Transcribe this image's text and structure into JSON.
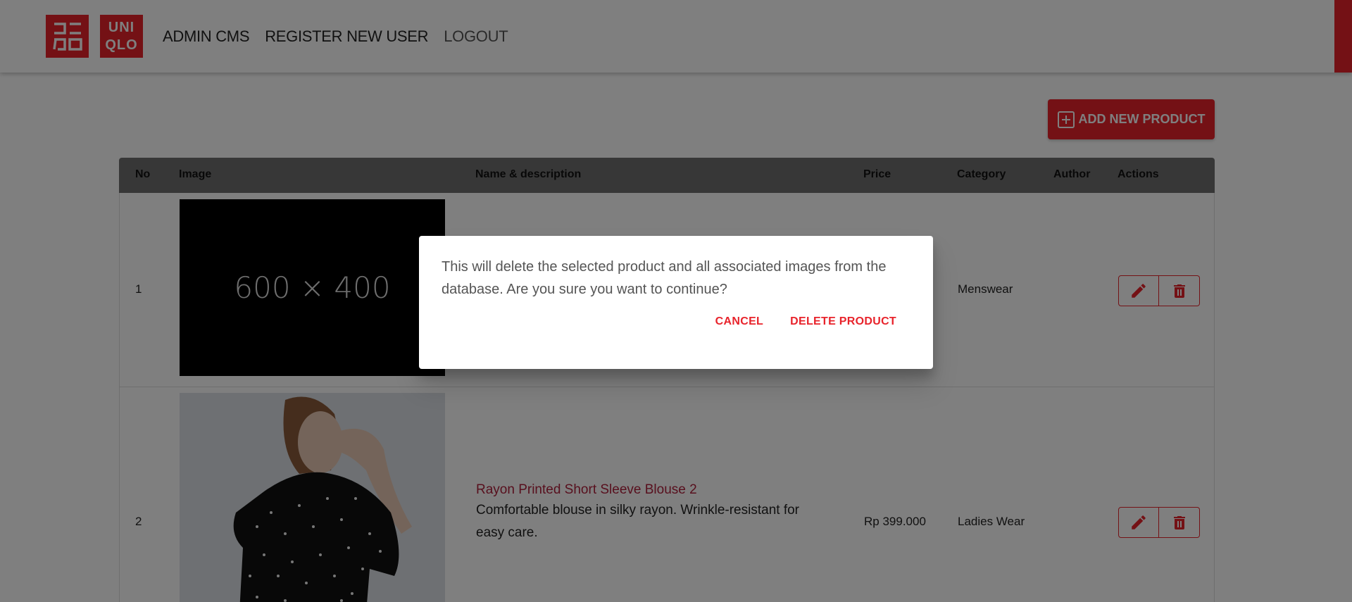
{
  "header": {
    "logo_top": "ユニクロ",
    "logo_text_line1": "UNI",
    "logo_text_line2": "QLO",
    "nav": [
      {
        "label": "ADMIN CMS"
      },
      {
        "label": "REGISTER NEW USER"
      },
      {
        "label": "LOGOUT"
      }
    ]
  },
  "toolbar": {
    "add_label": "ADD NEW PRODUCT"
  },
  "table": {
    "columns": [
      "No",
      "Image",
      "Name & description",
      "Price",
      "Category",
      "Author",
      "Actions"
    ],
    "rows": [
      {
        "no": "1",
        "image_placeholder": "600 × 400",
        "name": "",
        "description": "",
        "price": "",
        "category": "Menswear",
        "author": ""
      },
      {
        "no": "2",
        "image_placeholder": "",
        "name": "Rayon Printed Short Sleeve Blouse 2",
        "description": "Comfortable blouse in silky rayon. Wrinkle-resistant for easy care.",
        "price": "Rp 399.000",
        "category": "Ladies Wear",
        "author": ""
      }
    ]
  },
  "dialog": {
    "message": "This will delete the selected product and all associated images from the database. Are you sure you want to continue?",
    "cancel_label": "CANCEL",
    "confirm_label": "DELETE PRODUCT"
  },
  "colors": {
    "accent": "#e8232b",
    "overlay": "rgba(0,0,0,0.5)",
    "table_header": "#6f6f6f",
    "product_name": "#b0213c"
  },
  "icons": {
    "add": "plus-square-icon",
    "edit": "pencil-icon",
    "delete": "trash-icon"
  }
}
